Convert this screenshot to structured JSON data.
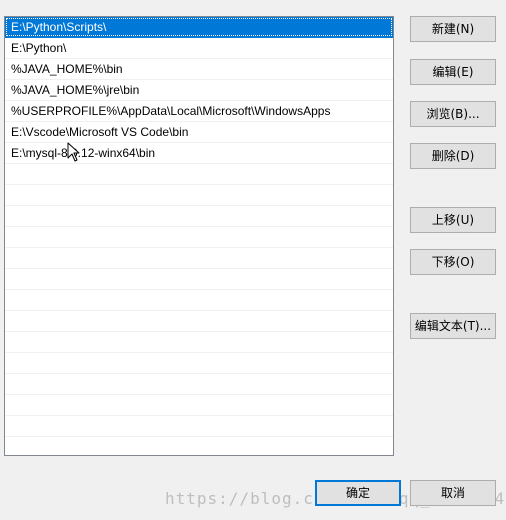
{
  "path_list": {
    "items": [
      {
        "label": "E:\\Python\\Scripts\\",
        "selected": true
      },
      {
        "label": "E:\\Python\\",
        "selected": false
      },
      {
        "label": "%JAVA_HOME%\\bin",
        "selected": false
      },
      {
        "label": "%JAVA_HOME%\\jre\\bin",
        "selected": false
      },
      {
        "label": "%USERPROFILE%\\AppData\\Local\\Microsoft\\WindowsApps",
        "selected": false
      },
      {
        "label": "E:\\Vscode\\Microsoft VS Code\\bin",
        "selected": false
      },
      {
        "label": "E:\\mysql-8.0.12-winx64\\bin",
        "selected": false
      }
    ],
    "selected_color": "#0078d7"
  },
  "buttons": {
    "new": "新建(N)",
    "edit": "编辑(E)",
    "browse": "浏览(B)...",
    "delete": "删除(D)",
    "move_up": "上移(U)",
    "move_down": "下移(O)",
    "edit_text": "编辑文本(T)...",
    "ok": "确定",
    "cancel": "取消"
  },
  "watermark": {
    "text": "https://blog.csdn.net/qq_41968640"
  },
  "icons": {
    "cursor": "mouse-pointer-icon"
  }
}
